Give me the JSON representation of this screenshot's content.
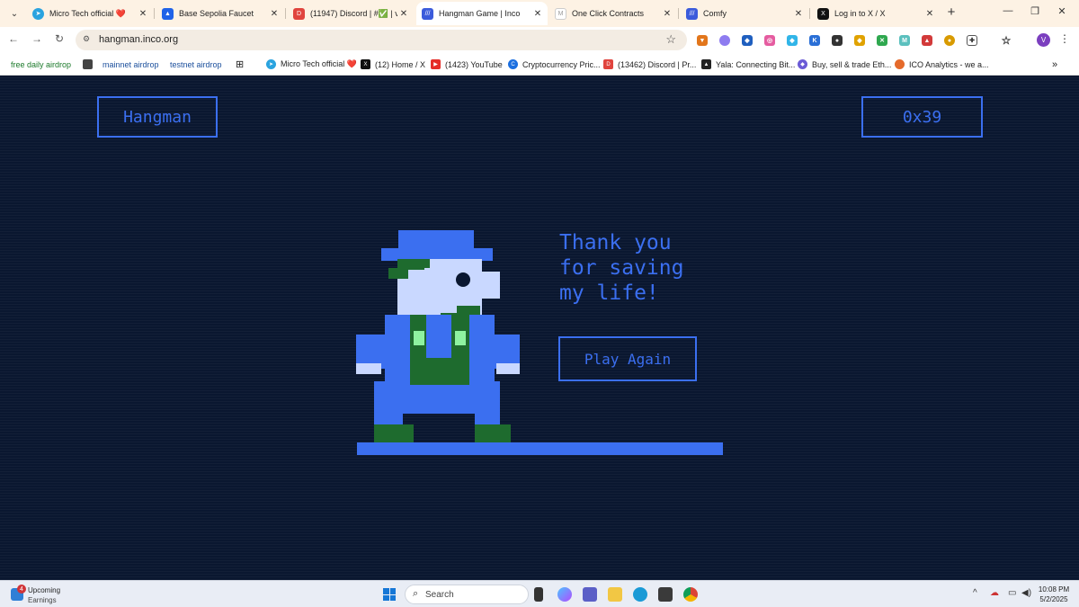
{
  "tabs": [
    {
      "title": "Micro Tech official ❤️",
      "favicon": "telegram-icon",
      "color": "#2aa3df"
    },
    {
      "title": "Base Sepolia Faucet",
      "favicon": "alchemy-icon",
      "color": "#1f62e8"
    },
    {
      "title": "(11947) Discord | #✅ | ve",
      "favicon": "discord-icon",
      "color": "#e0443e"
    },
    {
      "title": "Hangman Game | Inco",
      "favicon": "inco-icon",
      "color": "#3b5bdb",
      "active": true
    },
    {
      "title": "One Click Contracts",
      "favicon": "contracts-icon",
      "color": "#c9c9c9"
    },
    {
      "title": "Comfy",
      "favicon": "inco-icon",
      "color": "#3b5bdb"
    },
    {
      "title": "Log in to X / X",
      "favicon": "x-icon",
      "color": "#111111"
    }
  ],
  "address_bar": {
    "url": "hangman.inco.org"
  },
  "bookmarks": [
    {
      "label": "free daily airdrop",
      "style": "green"
    },
    {
      "label": "mainnet airdrop",
      "style": "blue",
      "favicon_color": "#444444"
    },
    {
      "label": "testnet airdrop",
      "style": "blue"
    },
    {
      "label": "Micro Tech official ❤️",
      "favicon_color": "#2aa3df"
    },
    {
      "label": "(12) Home / X",
      "favicon_color": "#111111"
    },
    {
      "label": "(1423) YouTube",
      "favicon_color": "#e52d27"
    },
    {
      "label": "Cryptocurrency Pric...",
      "favicon_color": "#1b6fe0"
    },
    {
      "label": "(13462) Discord | Pr...",
      "favicon_color": "#e0443e"
    },
    {
      "label": "Yala: Connecting Bit...",
      "favicon_color": "#222222"
    },
    {
      "label": "Buy, sell & trade Eth...",
      "favicon_color": "#6b5bd6"
    },
    {
      "label": "ICO Analytics - we a...",
      "favicon_color": "#e56a2b"
    }
  ],
  "bookmarks_overflow": "»",
  "game": {
    "title": "Hangman",
    "wallet": "0x39",
    "message_lines": [
      "Thank you",
      "for saving",
      "my life!"
    ],
    "play_again": "Play Again",
    "accent_color": "#3b6ff0"
  },
  "taskbar": {
    "weather_badge": "4",
    "weather_line1": "Upcoming",
    "weather_line2": "Earnings",
    "search_placeholder": "Search",
    "time": "10:08 PM",
    "date": "5/2/2025"
  }
}
